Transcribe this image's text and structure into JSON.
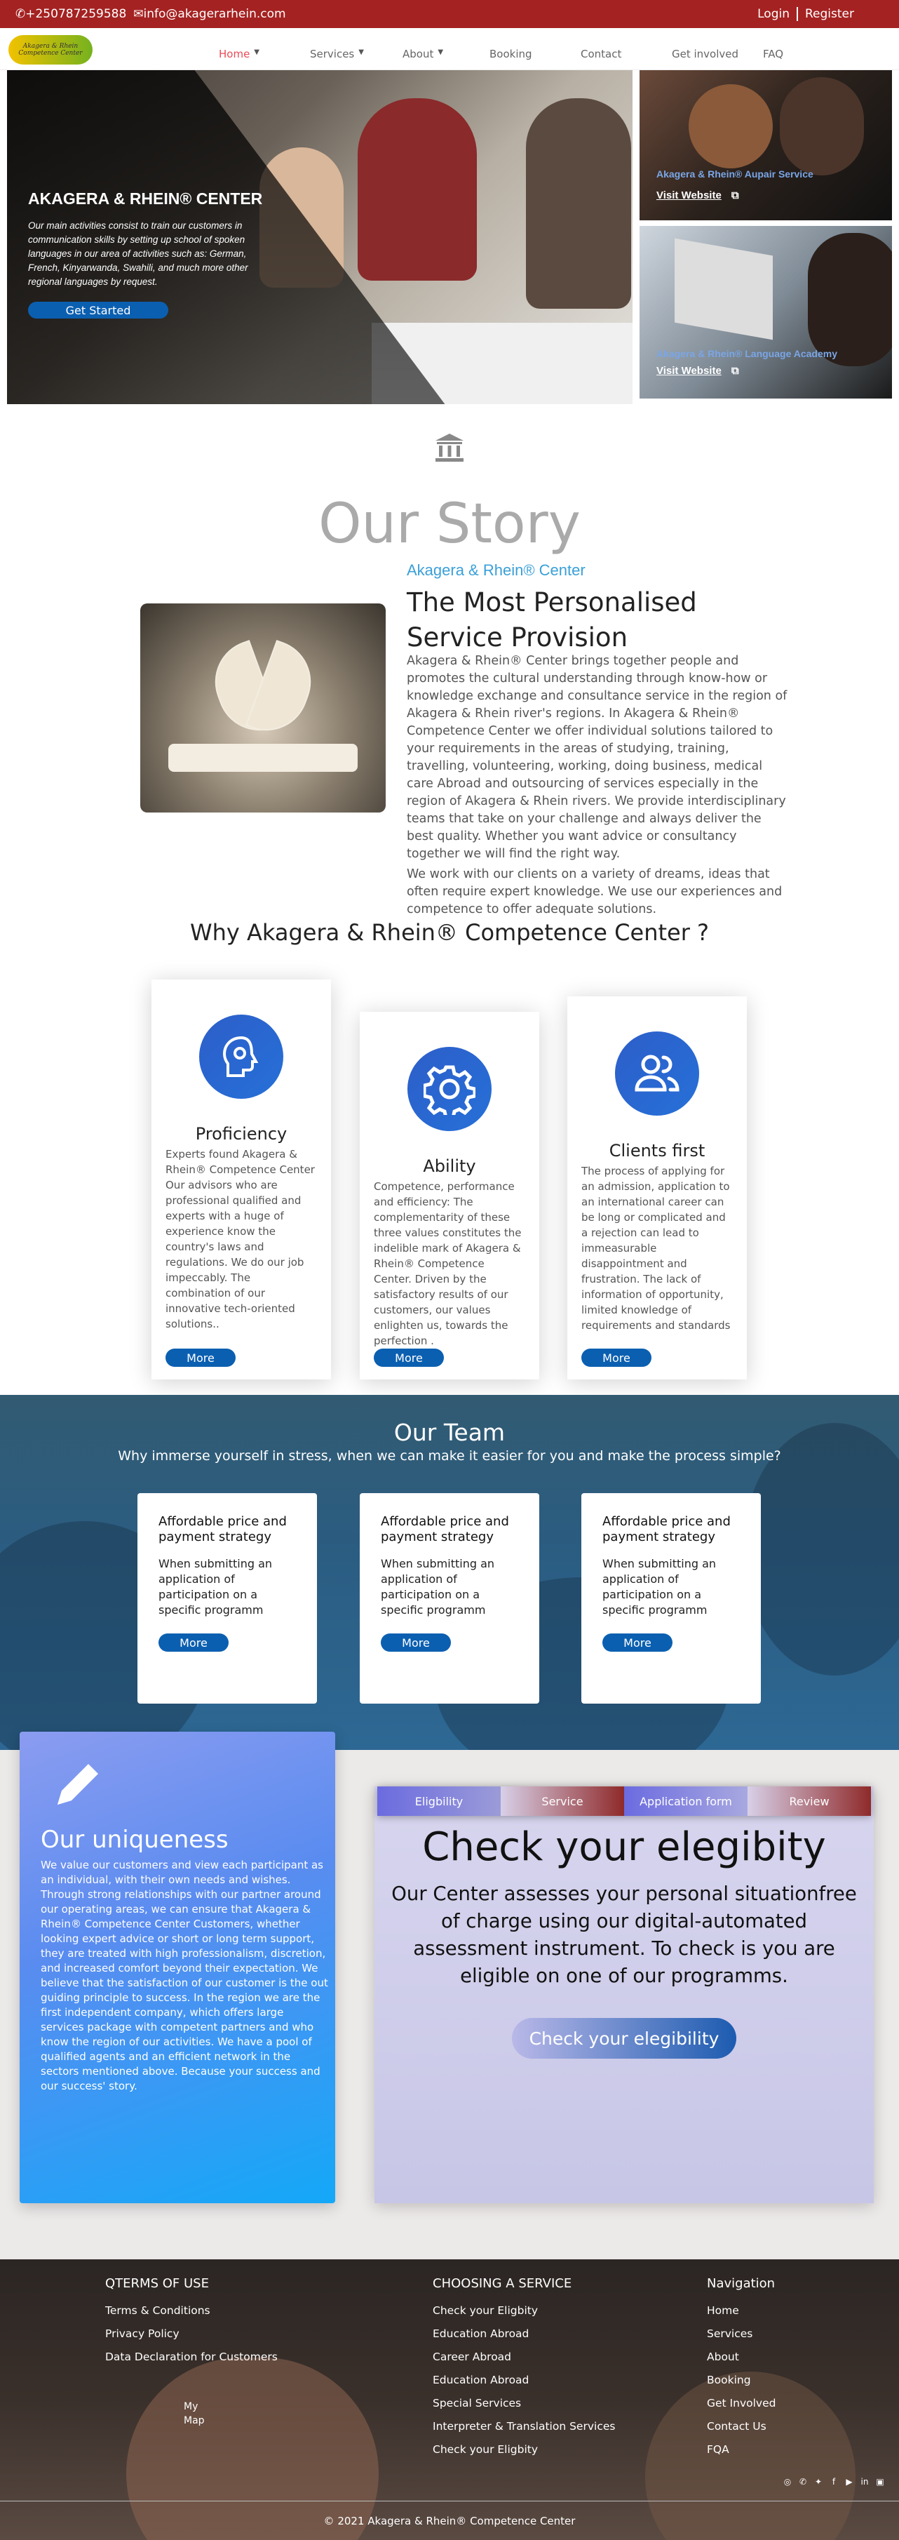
{
  "topbar": {
    "phone": "+250787259588",
    "email": "info@akagerarhein.com",
    "login": "Login",
    "register": "Register"
  },
  "logo": {
    "line1": "Akagera & Rhein",
    "line2": "Competence Center"
  },
  "nav": {
    "items": [
      {
        "label": "Home",
        "dropdown": true
      },
      {
        "label": "Services",
        "dropdown": true
      },
      {
        "label": "About",
        "dropdown": true
      },
      {
        "label": "Booking",
        "dropdown": false
      },
      {
        "label": "Contact",
        "dropdown": false
      },
      {
        "label": "Get involved",
        "dropdown": false
      },
      {
        "label": "FAQ",
        "dropdown": false
      }
    ]
  },
  "hero": {
    "title": "AKAGERA & RHEIN® CENTER",
    "text": "Our main activities consist to train our customers in communication skills by setting up school of spoken languages in our area of activities such as: German, French, Kinyarwanda, Swahili, and much more other regional languages by request.",
    "button": "Get Started"
  },
  "side_cards": [
    {
      "caption": "Akagera & Rhein® Aupair Service",
      "link": "Visit Website"
    },
    {
      "caption": "Akagera & Rhein® Language Academy",
      "link": "Visit Website"
    }
  ],
  "story": {
    "title": "Our Story",
    "subtitle": "Akagera & Rhein® Center",
    "heading": "The Most Personalised Service Provision",
    "p1": "Akagera & Rhein® Center brings together people and promotes the cultural understanding through know-how or knowledge exchange and consultance service in the region of Akagera & Rhein river's regions. In Akagera & Rhein® Competence Center we offer individual solutions tailored to your requirements in the areas of studying, training, travelling, volunteering, working, doing business, medical care Abroad and outsourcing of services especially in the region of Akagera & Rhein rivers. We provide interdisciplinary teams that take on your challenge and always deliver the best quality. Whether you want advice or consultancy together we will find the right way.",
    "p2": "We work with our clients on a variety of dreams, ideas that often require expert knowledge. We use our experiences and competence to offer adequate solutions."
  },
  "why": {
    "title": "Why Akagera & Rhein® Competence Center ?",
    "cards": [
      {
        "icon": "brain-gear-icon",
        "title": "Proficiency",
        "text": "Experts found Akagera & Rhein® Competence Center Our advisors who are professional qualified and experts with a huge of experience know the country's laws and regulations. We do our job impeccably. The combination of our innovative tech-oriented solutions..",
        "button": "More"
      },
      {
        "icon": "gear-icon",
        "title": "Ability",
        "text": "Competence, performance and efficiency: The complementarity of these three values constitutes the indelible mark of Akagera & Rhein® Competence Center. Driven by the satisfactory results of our customers, our values enlighten us, towards the perfection .",
        "button": "More"
      },
      {
        "icon": "users-icon",
        "title": "Clients first",
        "text": "The process of applying for an admission, application to an international career can be long or complicated and a rejection can lead to immeasurable disappointment and frustration. The lack of information of opportunity, limited knowledge of requirements and standards",
        "button": "More"
      }
    ]
  },
  "team": {
    "title": "Our Team",
    "subtitle": "Why immerse yourself in stress, when we can make it easier for you and make the process simple?",
    "cards": [
      {
        "title": "Affordable price and payment strategy",
        "text": "When submitting an application of participation on a specific programm",
        "button": "More"
      },
      {
        "title": "Affordable price and payment strategy",
        "text": "When submitting an application of participation on a specific programm",
        "button": "More"
      },
      {
        "title": "Affordable price and payment strategy",
        "text": "When submitting an application of participation on a specific programm",
        "button": "More"
      }
    ]
  },
  "uniqueness": {
    "title": "Our uniqueness",
    "text": "We value our customers and view each participant as an individual, with their own needs and wishes. Through strong relationships with our partner around our operating areas, we can ensure that Akagera & Rhein® Competence Center Customers, whether looking expert advice or short or long term support, they are treated with high professionalism, discretion, and increased comfort beyond their expectation. We believe that the satisfaction of our customer is the out guiding principle to success. In the region we are the first independent company, which offers large services package with competent partners and who know the region of our activities. We have a pool of qualified agents and an efficient network in the sectors mentioned above. Because your success and our success' story."
  },
  "eligibility": {
    "tabs": [
      "Eligbility",
      "Service",
      "Application form",
      "Review"
    ],
    "title": "Check your elegibity",
    "text": "Our Center assesses your personal situationfree of charge using our digital-automated assessment instrument. To check is you are eligible on one of our programms.",
    "button": "Check your elegibility"
  },
  "footer": {
    "col1": {
      "title": "QTERMS OF USE",
      "items": [
        "Terms & Conditions",
        "Privacy Policy",
        "Data Declaration for Customers"
      ]
    },
    "col2": {
      "title": "CHOOSING A SERVICE",
      "items": [
        "Check your Eligbity",
        "Education Abroad",
        "Career Abroad",
        "Education Abroad",
        "Special Services",
        "Interpreter & Translation Services",
        "Check your Eligbity"
      ]
    },
    "col3": {
      "title": "Navigation",
      "items": [
        "Home",
        "Services",
        "About",
        "Booking",
        "Get Involved",
        "Contact Us",
        "FQA"
      ]
    },
    "map": {
      "line1": "My",
      "line2": "Map"
    },
    "social": [
      "instagram-icon",
      "whatsapp-icon",
      "twitter-icon",
      "facebook-icon",
      "youtube-icon",
      "linkedin-icon",
      "calendar-icon"
    ],
    "copyright": "© 2021 Akagera & Rhein® Competence Center"
  },
  "colors": {
    "topbar": "#a52222",
    "accent_blue": "#0b5fb0",
    "active_nav": "#e94b57",
    "subtitle_blue": "#3aa0d8"
  }
}
